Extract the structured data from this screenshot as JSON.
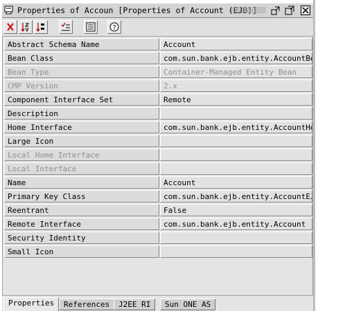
{
  "window": {
    "title": "Properties of Accoun [Properties of Account (EJB)]"
  },
  "toolbar": {
    "buttons": [
      {
        "icon": "red-cross-icon"
      },
      {
        "icon": "sort-alpha-icon"
      },
      {
        "icon": "sort-category-icon"
      },
      {
        "icon": "filter-icon"
      },
      {
        "icon": "customize-icon"
      },
      {
        "icon": "help-icon"
      }
    ]
  },
  "properties": [
    {
      "name": "Abstract Schema Name",
      "value": "Account",
      "disabled": false
    },
    {
      "name": "Bean Class",
      "value": "com.sun.bank.ejb.entity.AccountBean",
      "disabled": false
    },
    {
      "name": "Bean Type",
      "value": "Container-Managed Entity Bean",
      "disabled": true
    },
    {
      "name": "CMP Version",
      "value": "2.x",
      "disabled": true
    },
    {
      "name": "Component Interface Set",
      "value": "Remote",
      "disabled": false
    },
    {
      "name": "Description",
      "value": "",
      "disabled": false
    },
    {
      "name": "Home Interface",
      "value": "com.sun.bank.ejb.entity.AccountHome",
      "disabled": false
    },
    {
      "name": "Large Icon",
      "value": "",
      "disabled": false
    },
    {
      "name": "Local Home Interface",
      "value": "",
      "disabled": true
    },
    {
      "name": "Local Interface",
      "value": "",
      "disabled": true
    },
    {
      "name": "Name",
      "value": "Account",
      "disabled": false
    },
    {
      "name": "Primary Key Class",
      "value": "com.sun.bank.ejb.entity.AccountEJB",
      "disabled": false
    },
    {
      "name": "Reentrant",
      "value": "False",
      "disabled": false
    },
    {
      "name": "Remote Interface",
      "value": "com.sun.bank.ejb.entity.Account",
      "disabled": false
    },
    {
      "name": "Security Identity",
      "value": "",
      "disabled": false
    },
    {
      "name": "Small Icon",
      "value": "",
      "disabled": false
    }
  ],
  "tabs": [
    {
      "label": "Properties",
      "active": true
    },
    {
      "label": "References",
      "active": false
    },
    {
      "label": "J2EE RI",
      "active": false
    },
    {
      "label": "Sun ONE AS",
      "active": false
    }
  ]
}
